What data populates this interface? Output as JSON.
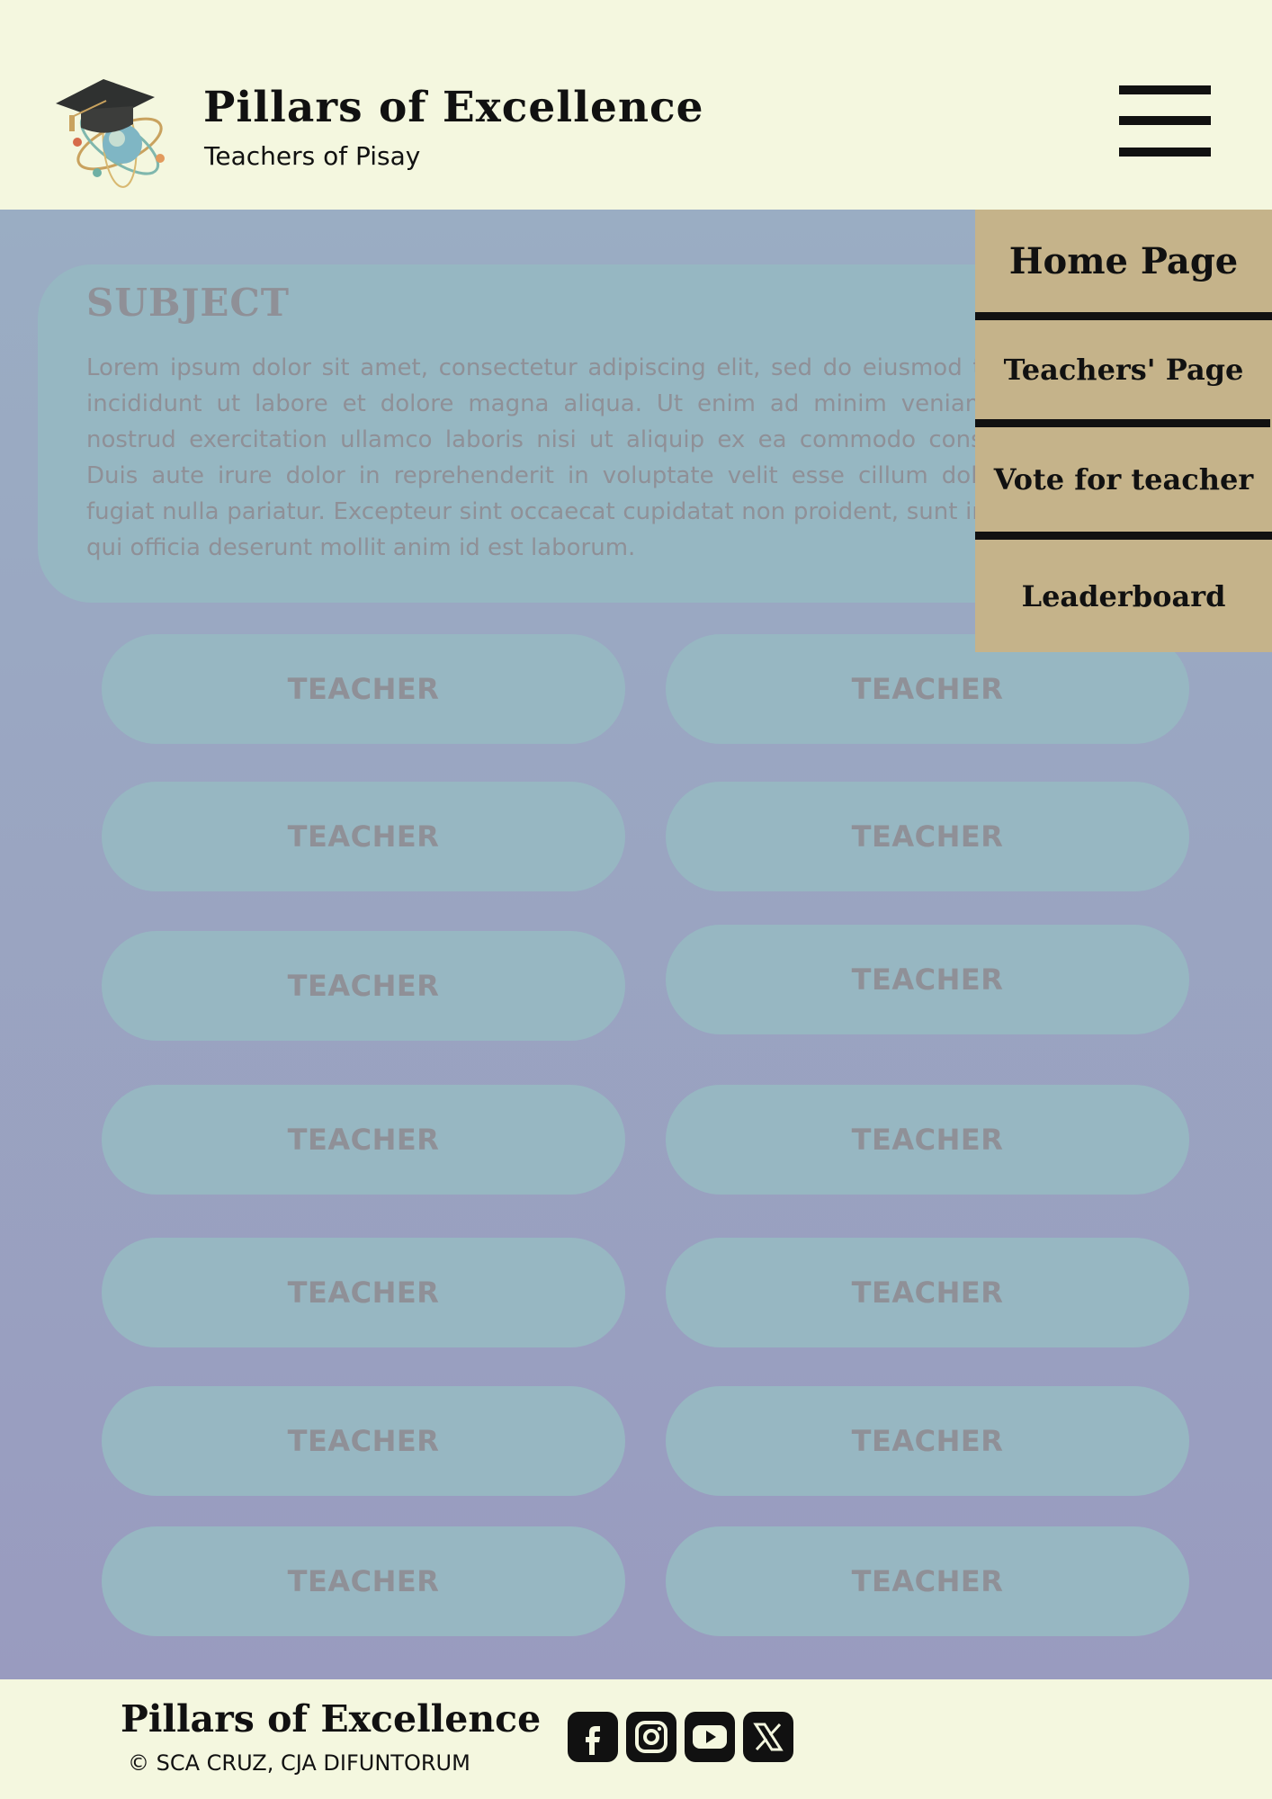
{
  "header": {
    "title": "Pillars of Excellence",
    "subtitle": "Teachers of Pisay"
  },
  "subject": {
    "title": "SUBJECT",
    "text": "Lorem ipsum dolor sit amet, consectetur adipiscing elit, sed do eiusmod tempor incididunt ut labore et dolore magna aliqua. Ut enim ad minim veniam, quis nostrud exercitation ullamco laboris nisi ut aliquip ex ea commodo consequat. Duis aute irure dolor in reprehenderit in voluptate velit esse cillum dolore eu fugiat nulla pariatur. Excepteur sint occaecat cupidatat non proident, sunt in culpa qui officia deserunt mollit anim id est laborum."
  },
  "teachers": [
    "TEACHER",
    "TEACHER",
    "TEACHER",
    "TEACHER",
    "TEACHER",
    "TEACHER",
    "TEACHER",
    "TEACHER",
    "TEACHER",
    "TEACHER",
    "TEACHER",
    "TEACHER",
    "TEACHER",
    "TEACHER"
  ],
  "menu": {
    "items": [
      {
        "label": "Home Page"
      },
      {
        "label": "Teachers' Page"
      },
      {
        "label": "Vote for teacher"
      },
      {
        "label": "Leaderboard"
      }
    ]
  },
  "footer": {
    "title": "Pillars of Excellence",
    "copyright": "© SCA CRUZ, CJA DIFUNTORUM",
    "social": [
      "facebook-icon",
      "instagram-icon",
      "youtube-icon",
      "x-icon"
    ]
  },
  "colors": {
    "cream": "#f4f7df",
    "menu": "#c5b38a",
    "card": "#97b7c2",
    "muted_text": "#8f9097"
  }
}
